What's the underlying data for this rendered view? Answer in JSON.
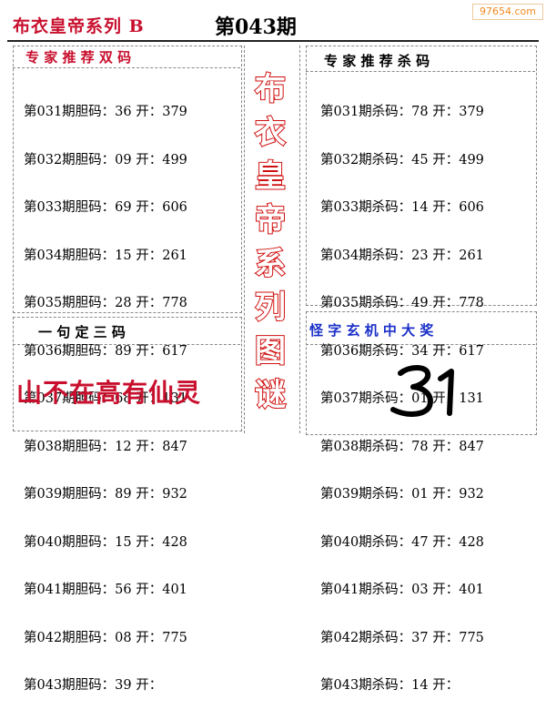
{
  "header": {
    "title": "布衣皇帝系列 B",
    "issue": "第043期"
  },
  "watermark": "97654.com",
  "left_panel": {
    "heading": "专 家 推 荐 双 码",
    "rows": [
      "第031期胆码：36 开：379",
      "第032期胆码：09 开：499",
      "第033期胆码：69 开：606",
      "第034期胆码：15 开：261",
      "第035期胆码：28 开：778",
      "第036期胆码：89 开：617",
      "第037期胆码：68 开：131",
      "第038期胆码：12 开：847",
      "第039期胆码：89 开：932",
      "第040期胆码：15 开：428",
      "第041期胆码：56 开：401",
      "第042期胆码：08 开：775",
      "第043期胆码：39 开："
    ]
  },
  "right_panel": {
    "heading": "专 家 推 荐 杀 码",
    "rows": [
      "第031期杀码：78 开：379",
      "第032期杀码：45 开：499",
      "第033期杀码：14 开：606",
      "第034期杀码：23 开：261",
      "第035期杀码：49 开：778",
      "第036期杀码：34 开：617",
      "第037期杀码：01 开：131",
      "第038期杀码：78 开：847",
      "第039期杀码：01 开：932",
      "第040期杀码：47 开：428",
      "第041期杀码：03 开：401",
      "第042期杀码：37 开：775",
      "第043期杀码：14 开："
    ]
  },
  "center_column": [
    "布",
    "衣",
    "皇",
    "帝",
    "系",
    "列",
    "图",
    "谜"
  ],
  "bottom_left": {
    "heading": "一 句 定 三 码",
    "slogan": "山不在高有仙灵"
  },
  "bottom_right": {
    "heading": "怪 字 玄 机 中 大 奖",
    "answer": "31"
  },
  "colors": {
    "red": "#c8102e",
    "blue": "#1a2fc8",
    "answer": "#000000"
  }
}
